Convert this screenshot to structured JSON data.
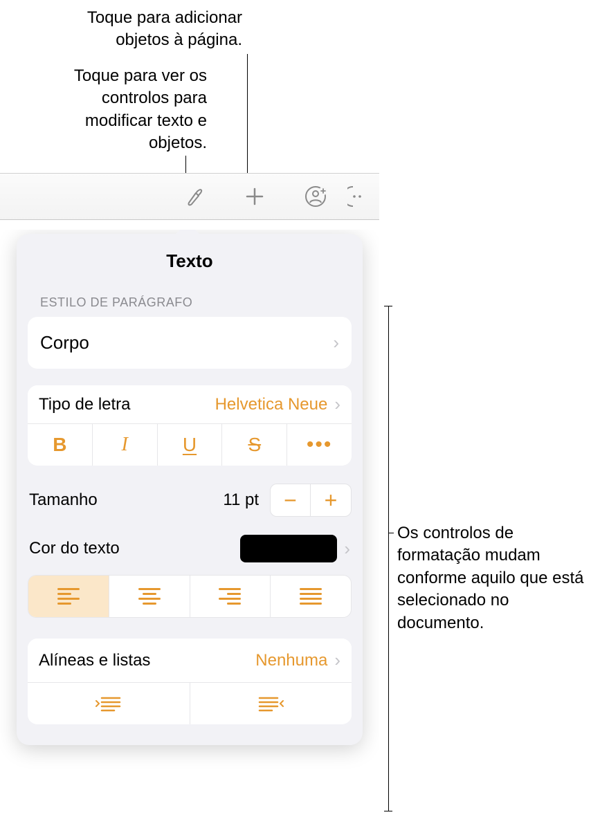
{
  "callouts": {
    "add_objects": "Toque para adicionar objetos à página.",
    "modify_controls": "Toque para ver os controlos para modificar texto e objetos.",
    "format_controls": "Os controlos de formatação mudam conforme aquilo que está selecionado no documento."
  },
  "toolbar": {
    "format_icon": "format-brush-icon",
    "add_icon": "plus-icon",
    "collab_icon": "person-add-icon",
    "more_icon": "more-circle-icon"
  },
  "panel": {
    "title": "Texto",
    "paragraph_style_label": "ESTILO DE PARÁGRAFO",
    "paragraph_style_value": "Corpo",
    "font_label": "Tipo de letra",
    "font_value": "Helvetica Neue",
    "size_label": "Tamanho",
    "size_value": "11 pt",
    "text_color_label": "Cor do texto",
    "text_color_hex": "#000000",
    "bullets_label": "Alíneas e listas",
    "bullets_value": "Nenhuma",
    "style_buttons": {
      "bold": "B",
      "italic": "I",
      "underline": "U",
      "strike": "S",
      "more": "•••"
    }
  }
}
